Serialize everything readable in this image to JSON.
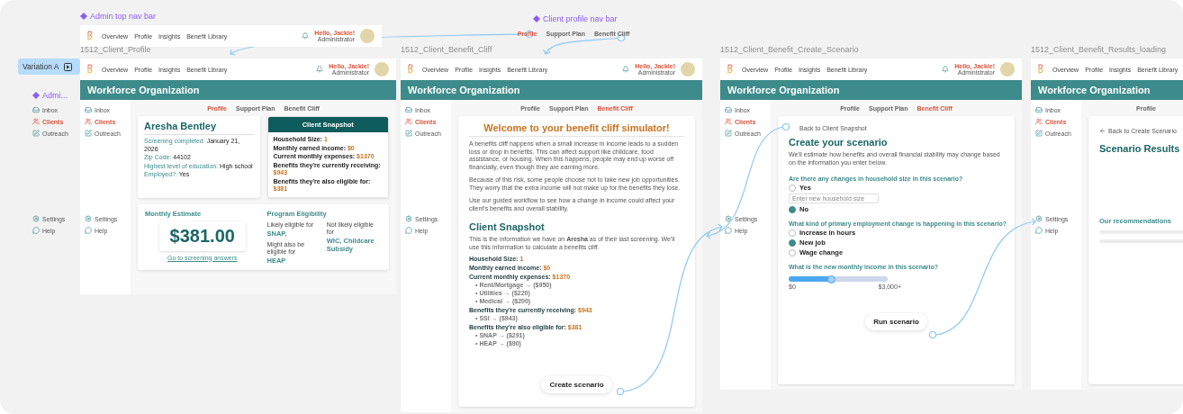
{
  "admin_nav_component": {
    "label": "Admin top nav bar",
    "nav": {
      "links": [
        "Overview",
        "Profile",
        "Insights",
        "Benefit Library"
      ],
      "greeting": "Hello, Jackie!",
      "role": "Administrator"
    }
  },
  "client_nav_component": {
    "label": "Client profile nav bar",
    "tabs": [
      {
        "label": "Profile",
        "selected": true
      },
      {
        "label": "Support Plan",
        "selected": false
      },
      {
        "label": "Benefit Cliff",
        "selected": false
      }
    ]
  },
  "variation_tag": "Variation A",
  "side_nav_component": {
    "label": "Admi...",
    "sidebar": {
      "items": [
        {
          "label": "Inbox",
          "selected": false
        },
        {
          "label": "Clients",
          "selected": true
        },
        {
          "label": "Outreach",
          "selected": false
        }
      ],
      "bottom_items": [
        {
          "label": "Settings",
          "selected": false
        },
        {
          "label": "Help",
          "selected": false
        }
      ]
    }
  },
  "frames": [
    {
      "title": "1512_Client_Profile",
      "kind": "profile",
      "nav": {
        "links": [
          "Overview",
          "Profile",
          "Insights",
          "Benefit Library"
        ],
        "greeting": "Hello, Jackie!",
        "role": "Administrator"
      },
      "header": "Workforce Organization",
      "sidebar": {
        "items": [
          {
            "label": "Inbox",
            "selected": false
          },
          {
            "label": "Clients",
            "selected": true
          },
          {
            "label": "Outreach",
            "selected": false
          }
        ],
        "bottom_items": [
          {
            "label": "Settings",
            "selected": false
          },
          {
            "label": "Help",
            "selected": false
          }
        ]
      },
      "tabs": [
        {
          "label": "Profile",
          "selected": true
        },
        {
          "label": "Support Plan",
          "selected": false
        },
        {
          "label": "Benefit Cliff",
          "selected": false
        }
      ],
      "content": {
        "name": "Aresha Bentley",
        "fields": [
          {
            "label": "Screening completed:",
            "value": "January 21, 2026"
          },
          {
            "label": "Zip Code:",
            "value": "44102"
          },
          {
            "label": "Highest level of education:",
            "value": "High school"
          },
          {
            "label": "Employed?:",
            "value": "Yes"
          }
        ],
        "snapshot": {
          "title": "Client Snapshot",
          "rows": [
            {
              "label": "Household Size:",
              "value": "1"
            },
            {
              "label": "Monthly earned income:",
              "value": "$0"
            },
            {
              "label": "Current monthly expenses:",
              "value": "$1370"
            },
            {
              "label": "Benefits they're currently receiving:",
              "value": "$943"
            },
            {
              "label": "Benefits they're also eligible for:",
              "value": "$381"
            }
          ]
        },
        "estimate": {
          "title": "Monthly Estimate",
          "amount": "$381.00",
          "link": "Go to screening answers"
        },
        "eligibility": {
          "title": "Program Eligibility",
          "groups": [
            {
              "label": "Likely eligible for",
              "value": "SNAP,"
            },
            {
              "label": "Might also be eligible for",
              "value": "HEAP"
            },
            {
              "label": "Not likely eligible for",
              "value": "WIC, Childcare Subsidy"
            }
          ]
        }
      }
    },
    {
      "title": "1512_Client_Benefit_Cliff",
      "kind": "cliff",
      "nav": {
        "links": [
          "Overview",
          "Profile",
          "Insights",
          "Benefit Library"
        ],
        "greeting": "Hello, Jackie!",
        "role": "Administrator"
      },
      "header": "Workforce Organization",
      "sidebar": {
        "items": [
          {
            "label": "Inbox",
            "selected": false
          },
          {
            "label": "Clients",
            "selected": true
          },
          {
            "label": "Outreach",
            "selected": false
          }
        ],
        "bottom_items": [
          {
            "label": "Settings",
            "selected": false
          },
          {
            "label": "Help",
            "selected": false
          }
        ]
      },
      "tabs": [
        {
          "label": "Profile",
          "selected": false
        },
        {
          "label": "Support Plan",
          "selected": false
        },
        {
          "label": "Benefit Cliff",
          "selected": true
        }
      ],
      "content": {
        "title": "Welcome to your benefit cliff simulator!",
        "paragraphs": [
          "A benefits cliff happens when a small increase in income leads to a sudden loss or drop in benefits. This can affect support like childcare, food assistance, or housing. When this happens, people may end up worse off financially, even though they are earning more.",
          "Because of this risk, some people choose not to take new job opportunities. They worry that the extra income will not make up for the benefits they lose.",
          "Use our guided workflow to see how a change in income could affect your client's benefits and overall stability."
        ],
        "snapshot_title": "Client Snapshot",
        "intro": "This is the information we have on **Aresha** as of their last screening. We'll use this information to calculate a benefits cliff.",
        "rows": [
          {
            "label": "Household Size:",
            "value": "1"
          },
          {
            "label": "Monthly earned income:",
            "value": "$0"
          },
          {
            "label": "Current monthly expenses:",
            "value": "$1370",
            "items": [
              "• Rent/Mortgage  → ($950)",
              "• Utilities → ($220)",
              "• Medical → ($200)"
            ]
          },
          {
            "label": "Benefits they're currently receiving:",
            "value": "$943",
            "items": [
              "• SSI → ($943)"
            ]
          },
          {
            "label": "Benefits they're also eligible for:",
            "value": "$381",
            "items": [
              "• SNAP → ($291)",
              "• HEAP → ($90)"
            ]
          }
        ],
        "button": "Create scenario"
      }
    },
    {
      "title": "1512_Client_Benefit_Create_Scenario",
      "kind": "scenario",
      "nav": {
        "links": [
          "Overview",
          "Profile",
          "Insights",
          "Benefit Library"
        ],
        "greeting": "Hello, Jackie!",
        "role": "Administrator"
      },
      "header": "Workforce Organization",
      "sidebar": {
        "items": [
          {
            "label": "Inbox",
            "selected": false
          },
          {
            "label": "Clients",
            "selected": true
          },
          {
            "label": "Outreach",
            "selected": false
          }
        ],
        "bottom_items": [
          {
            "label": "Settings",
            "selected": false
          },
          {
            "label": "Help",
            "selected": false
          }
        ]
      },
      "tabs": [
        {
          "label": "Profile",
          "selected": false
        },
        {
          "label": "Support Plan",
          "selected": false
        },
        {
          "label": "Benefit Cliff",
          "selected": true
        }
      ],
      "content": {
        "back": "Back to Client Snapshot",
        "title": "Create your scenario",
        "description": "We'll estimate how benefits and overall financial stability may change based on the information you enter below.",
        "questions": [
          {
            "kind": "radio",
            "label": "Are there any changes in household size in this scenario?",
            "options": [
              {
                "label": "Yes",
                "selected": false,
                "field": {
                  "placeholder": "Enter new household size"
                }
              },
              {
                "label": "No",
                "selected": true
              }
            ]
          },
          {
            "kind": "radio",
            "label": "What kind of primary employment change is happening in this scenario?",
            "options": [
              {
                "label": "Increase in hours",
                "selected": false
              },
              {
                "label": "New job",
                "selected": true
              },
              {
                "label": "Wage change",
                "selected": false
              }
            ]
          },
          {
            "kind": "slider",
            "label": "What is the new monthly income in this scenario?",
            "level": 0.43,
            "min": "$0",
            "max": "$3,000+"
          }
        ],
        "button": "Run scenario"
      }
    },
    {
      "title": "1512_Client_Benefit_Results_loading",
      "kind": "results",
      "nav": {
        "links": [
          "Overview",
          "Profile",
          "Insights",
          "Benefit Library"
        ]
      },
      "header": "Workforce Organization",
      "sidebar": {
        "items": [
          {
            "label": "Inbox",
            "selected": false
          },
          {
            "label": "Clients",
            "selected": true
          },
          {
            "label": "Outreach",
            "selected": false
          }
        ],
        "bottom_items": [
          {
            "label": "Settings",
            "selected": false
          },
          {
            "label": "Help",
            "selected": false
          }
        ]
      },
      "tabs": [
        {
          "label": "Profile",
          "selected": false
        }
      ],
      "content": {
        "back": "Back to Create Scenario",
        "title": "Scenario Results",
        "section": "Our recommendations"
      }
    }
  ]
}
